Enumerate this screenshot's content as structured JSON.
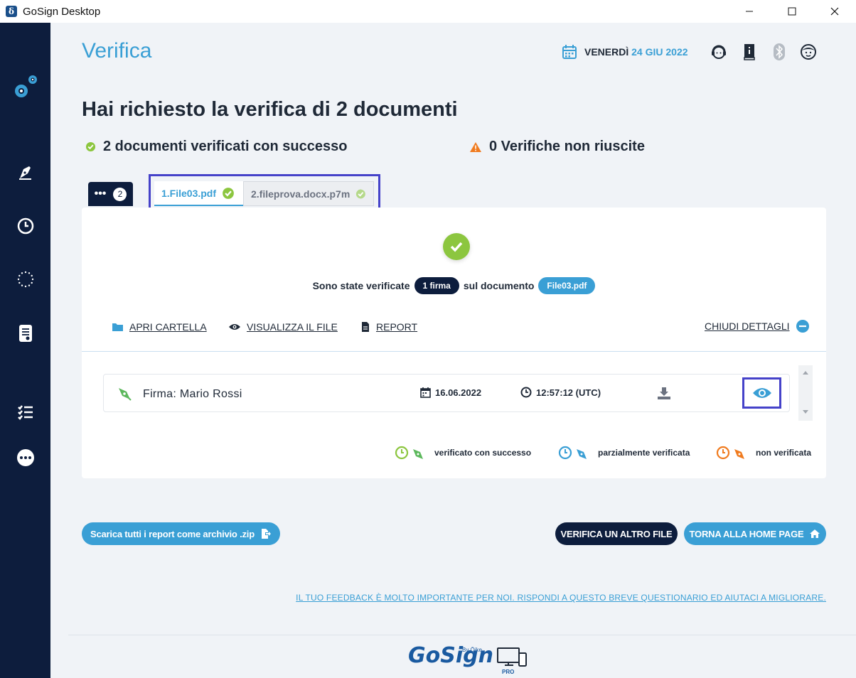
{
  "window": {
    "title": "GoSign Desktop",
    "app_icon_glyph": "δ"
  },
  "header": {
    "title": "Verifica",
    "date_day": "VENERDÌ",
    "date_value": "24 GIU 2022",
    "icons": [
      "calendar-icon",
      "support-headset-icon",
      "guide-book-icon",
      "bluetooth-icon",
      "user-avatar-icon"
    ]
  },
  "sidebar": {
    "icons": [
      "settings-gears-icon",
      "sign-pen-icon",
      "clock-history-icon",
      "eu-stars-icon",
      "document-verify-icon",
      "checklist-icon",
      "more-dots-icon"
    ]
  },
  "summary": {
    "headline": "Hai richiesto la verifica di 2 documenti",
    "success_text": "2 documenti verificati con successo",
    "failure_text": "0 Verifiche non riuscite"
  },
  "tabs": {
    "overflow_label": "•••",
    "count": "2",
    "items": [
      {
        "label": "1.File03.pdf"
      },
      {
        "label": "2.fileprova.docx.p7m"
      }
    ]
  },
  "detail": {
    "verified_prefix": "Sono state verificate",
    "signatures_pill": "1 firma",
    "verified_middle": "sul documento",
    "document_pill": "File03.pdf",
    "actions": {
      "open_folder": "APRI CARTELLA",
      "view_file": "VISUALIZZA IL FILE",
      "report": "REPORT",
      "close_details": "CHIUDI DETTAGLI"
    },
    "signature": {
      "name": "Firma: Mario Rossi",
      "date": "16.06.2022",
      "time": "12:57:12 (UTC)"
    },
    "legend": {
      "success": "verificato con successo",
      "partial": "parzialmente verificata",
      "failed": "non verificata"
    }
  },
  "buttons": {
    "download_zip": "Scarica tutti i report come archivio .zip",
    "verify_another": "VERIFICA UN ALTRO FILE",
    "home": "TORNA ALLA HOME PAGE"
  },
  "feedback": "IL TUO FEEDBACK È MOLTO IMPORTANTE PER NOI. RISPONDI A QUESTO BREVE QUESTIONARIO ED AIUTACI A MIGLIORARE.",
  "footer": {
    "logo_text": "GoSign",
    "logo_by": "By Ōike",
    "logo_edition": "PRO"
  },
  "colors": {
    "accent": "#3a9fd5",
    "navy": "#0d1d3d",
    "success": "#8cc63f",
    "warning": "#f07b1f",
    "partial": "#3a9fd5",
    "highlight": "#4542c9"
  }
}
